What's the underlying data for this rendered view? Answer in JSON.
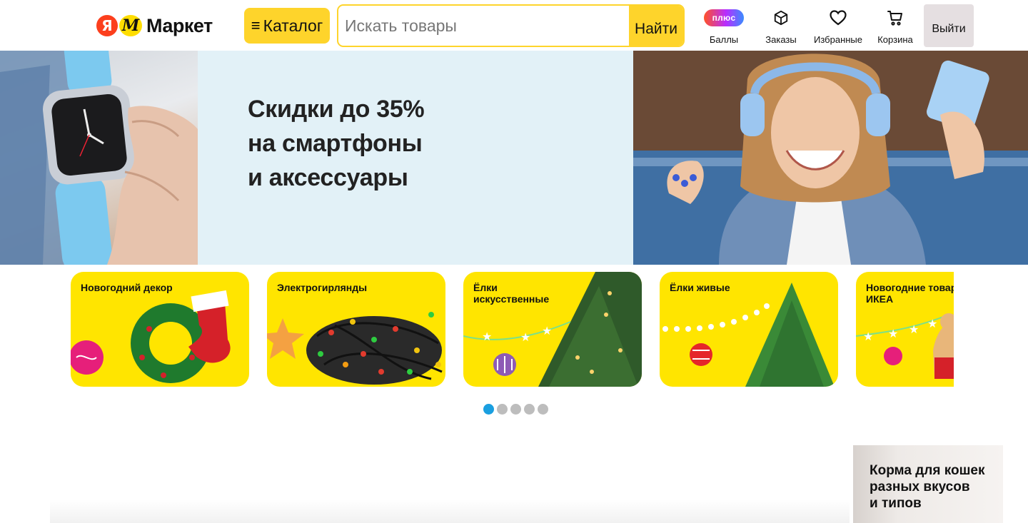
{
  "header": {
    "logo": {
      "ya": "Я",
      "m": "М",
      "text": "Маркет"
    },
    "catalog_label": "Каталог",
    "search": {
      "placeholder": "Искать товары",
      "value": "",
      "button_label": "Найти"
    },
    "nav": [
      {
        "label": "Баллы",
        "icon": "plus-badge-icon",
        "badge": "плюс"
      },
      {
        "label": "Заказы",
        "icon": "box-icon"
      },
      {
        "label": "Избранные",
        "icon": "heart-icon"
      },
      {
        "label": "Корзина",
        "icon": "cart-icon"
      }
    ],
    "logout_label": "Выйти"
  },
  "banner": {
    "title_lines": [
      "Скидки до 35%",
      "на смартфоны",
      "и аксессуары"
    ]
  },
  "categories": [
    {
      "label": "Новогодний декор"
    },
    {
      "label": "Электрогирлянды"
    },
    {
      "label": "Ёлки искусственные"
    },
    {
      "label": "Ёлки живые"
    },
    {
      "label": "Новогодние товары ИКЕА"
    }
  ],
  "carousel": {
    "page_count": 5,
    "active_index": 0
  },
  "promo": {
    "text_lines": [
      "Корма для кошек",
      "разных вкусов",
      "и типов"
    ]
  },
  "colors": {
    "brand_yellow": "#fed42b",
    "tile_yellow": "#ffe500",
    "ya_red": "#fc3f1d",
    "dot_active": "#1a9fe0",
    "dot_inactive": "#bdbdbd"
  }
}
